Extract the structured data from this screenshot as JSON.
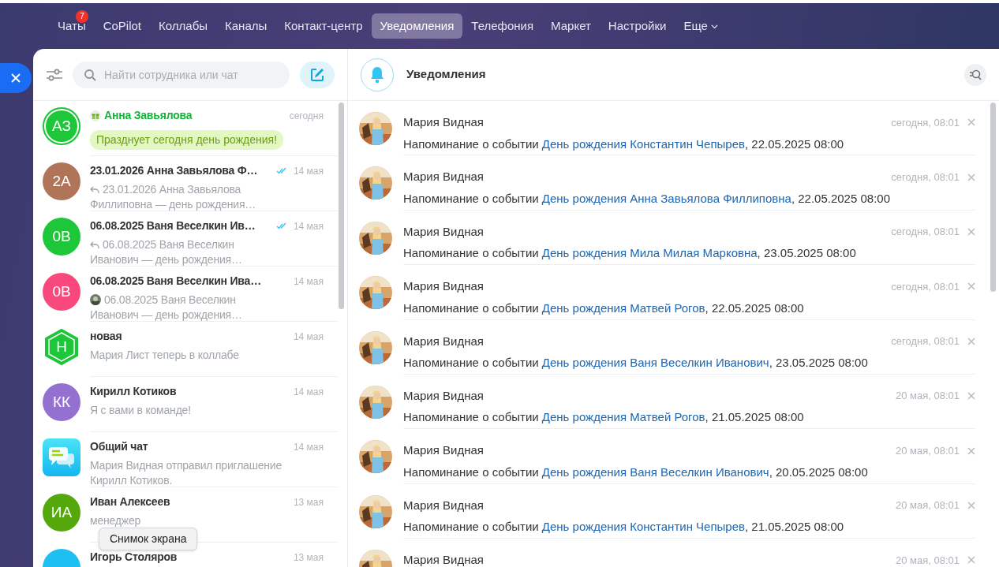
{
  "nav": {
    "items": [
      {
        "label": "Чаты",
        "selected": false,
        "badge": "7",
        "has_menu": false
      },
      {
        "label": "CoPilot",
        "selected": false,
        "has_menu": false
      },
      {
        "label": "Коллабы",
        "selected": false,
        "has_menu": false
      },
      {
        "label": "Каналы",
        "selected": false,
        "has_menu": false
      },
      {
        "label": "Контакт-центр",
        "selected": false,
        "has_menu": false
      },
      {
        "label": "Уведомления",
        "selected": true,
        "has_menu": false
      },
      {
        "label": "Телефония",
        "selected": false,
        "has_menu": false
      },
      {
        "label": "Маркет",
        "selected": false,
        "has_menu": false
      },
      {
        "label": "Настройки",
        "selected": false,
        "has_menu": false
      },
      {
        "label": "Еще",
        "selected": false,
        "has_menu": true
      }
    ]
  },
  "search": {
    "placeholder": "Найти сотрудника или чат"
  },
  "chats": [
    {
      "kind": "birthday",
      "avatar": {
        "kind": "circle",
        "initials": "АЗ",
        "color": "#1ec639"
      },
      "title": "Анна Завьялова",
      "date": "сегодня",
      "preview": {
        "kind": "plain",
        "text": "Празднует сегодня день рождения!"
      },
      "read": false
    },
    {
      "kind": "chat",
      "avatar": {
        "kind": "circle",
        "initials": "2А",
        "color": "#b07558"
      },
      "title": "23.01.2026 Анна Завьялова Ф…",
      "date": "14 мая",
      "preview": {
        "kind": "reply",
        "text": "23.01.2026 Анна Завьялова Филлиповна — день рождения…"
      },
      "read": true
    },
    {
      "kind": "chat",
      "avatar": {
        "kind": "circle",
        "initials": "0В",
        "color": "#1ec639"
      },
      "title": "06.08.2025 Ваня Веселкин Ив…",
      "date": "14 мая",
      "preview": {
        "kind": "reply",
        "text": "06.08.2025 Ваня Веселкин Иванович — день рождения…"
      },
      "read": true
    },
    {
      "kind": "chat",
      "avatar": {
        "kind": "circle",
        "initials": "0В",
        "color": "#f9487c"
      },
      "title": "06.08.2025 Ваня Веселкин Ива…",
      "date": "14 мая",
      "preview": {
        "kind": "sender",
        "text": "06.08.2025 Ваня Веселкин Иванович — день рождения…"
      },
      "read": false
    },
    {
      "kind": "chat",
      "avatar": {
        "kind": "hexagon",
        "initials": "Н",
        "color": "#1ec639"
      },
      "title": "новая",
      "date": "14 мая",
      "preview": {
        "kind": "plain",
        "text": "Мария Лист теперь в коллабе"
      },
      "read": false
    },
    {
      "kind": "chat",
      "avatar": {
        "kind": "circle",
        "initials": "КК",
        "color": "#9470d0"
      },
      "title": "Кирилл Котиков",
      "date": "14 мая",
      "preview": {
        "kind": "plain",
        "text": "Я с вами в команде!"
      },
      "read": false
    },
    {
      "kind": "chat",
      "avatar": {
        "kind": "app",
        "color": "#13b6f0"
      },
      "title": "Общий чат",
      "date": "14 мая",
      "preview": {
        "kind": "plain",
        "text": "Мария Видная отправил приглашение Кирилл Котиков."
      },
      "read": false
    },
    {
      "kind": "chat",
      "avatar": {
        "kind": "circle",
        "initials": "ИА",
        "color": "#55a80b"
      },
      "title": "Иван Алексеев",
      "date": "13 мая",
      "preview": {
        "kind": "plain",
        "text": "менеджер"
      },
      "read": false
    },
    {
      "kind": "chat",
      "avatar": {
        "kind": "circle",
        "color": "#1ec0f2"
      },
      "title": "Игорь Столяров",
      "date": "13 мая",
      "read": false
    }
  ],
  "notifications": {
    "title": "Уведомления",
    "items": [
      {
        "author": "Мария Видная",
        "time": "сегодня, 08:01",
        "text": "Напоминание о событии ",
        "link": "День рождения Константин Чепырев",
        "suffix": ", 22.05.2025 08:00"
      },
      {
        "author": "Мария Видная",
        "time": "сегодня, 08:01",
        "text": "Напоминание о событии ",
        "link": "День рождения Анна Завьялова Филлиповна",
        "suffix": ", 22.05.2025 08:00"
      },
      {
        "author": "Мария Видная",
        "time": "сегодня, 08:01",
        "text": "Напоминание о событии ",
        "link": "День рождения Мила Милая Марковна",
        "suffix": ", 23.05.2025 08:00"
      },
      {
        "author": "Мария Видная",
        "time": "сегодня, 08:01",
        "text": "Напоминание о событии ",
        "link": "День рождения Матвей Рогов",
        "suffix": ", 22.05.2025 08:00"
      },
      {
        "author": "Мария Видная",
        "time": "сегодня, 08:01",
        "text": "Напоминание о событии ",
        "link": "День рождения Ваня Веселкин Иванович",
        "suffix": ", 23.05.2025 08:00"
      },
      {
        "author": "Мария Видная",
        "time": "20 мая, 08:01",
        "text": "Напоминание о событии ",
        "link": "День рождения Матвей Рогов",
        "suffix": ", 21.05.2025 08:00"
      },
      {
        "author": "Мария Видная",
        "time": "20 мая, 08:01",
        "text": "Напоминание о событии ",
        "link": "День рождения Ваня Веселкин Иванович",
        "suffix": ", 20.05.2025 08:00"
      },
      {
        "author": "Мария Видная",
        "time": "20 мая, 08:01",
        "text": "Напоминание о событии ",
        "link": "День рождения Константин Чепырев",
        "suffix": ", 21.05.2025 08:00"
      },
      {
        "author": "Мария Видная",
        "time": "20 мая, 08:01"
      }
    ]
  },
  "tooltip": "Снимок экрана"
}
